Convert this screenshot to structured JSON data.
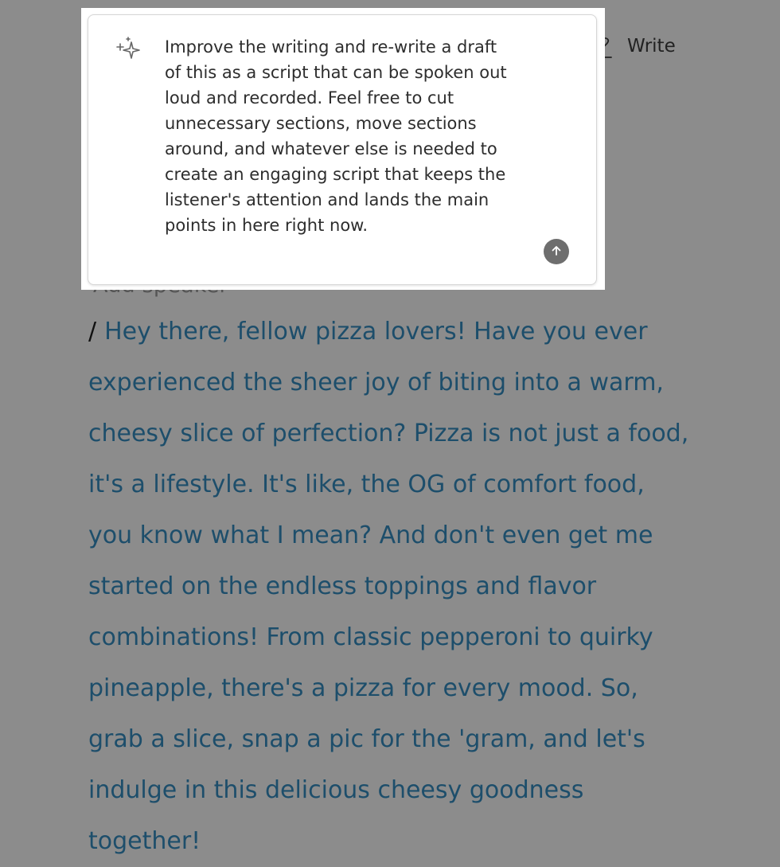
{
  "toolbar": {
    "write_label": "Write",
    "write_icon": "pen-scribble-icon"
  },
  "ai_prompt": {
    "icon": "sparkle-icon",
    "text": "Improve the writing and re-write a draft of this as a script that can be spoken out loud and recorded. Feel free to cut unnecessary sections, move sections around, and whatever else is needed to create an engaging script that keeps the listener's attention and lands the main points in here right now.",
    "send_icon": "arrow-up-icon"
  },
  "document": {
    "speaker_placeholder": "Add speaker",
    "slash": "/",
    "script_text": "Hey there, fellow pizza lovers! Have you ever experienced the sheer joy of biting into a warm, cheesy slice of perfection? Pizza is not just a food, it's a lifestyle. It's like, the OG of comfort food, you know what I mean? And don't even get me started on the endless toppings and flavor combinations! From classic pepperoni to quirky pineapple, there's a pizza for every mood. So, grab a slice, snap a pic for the 'gram, and let's indulge in this delicious cheesy goodness together!"
  }
}
